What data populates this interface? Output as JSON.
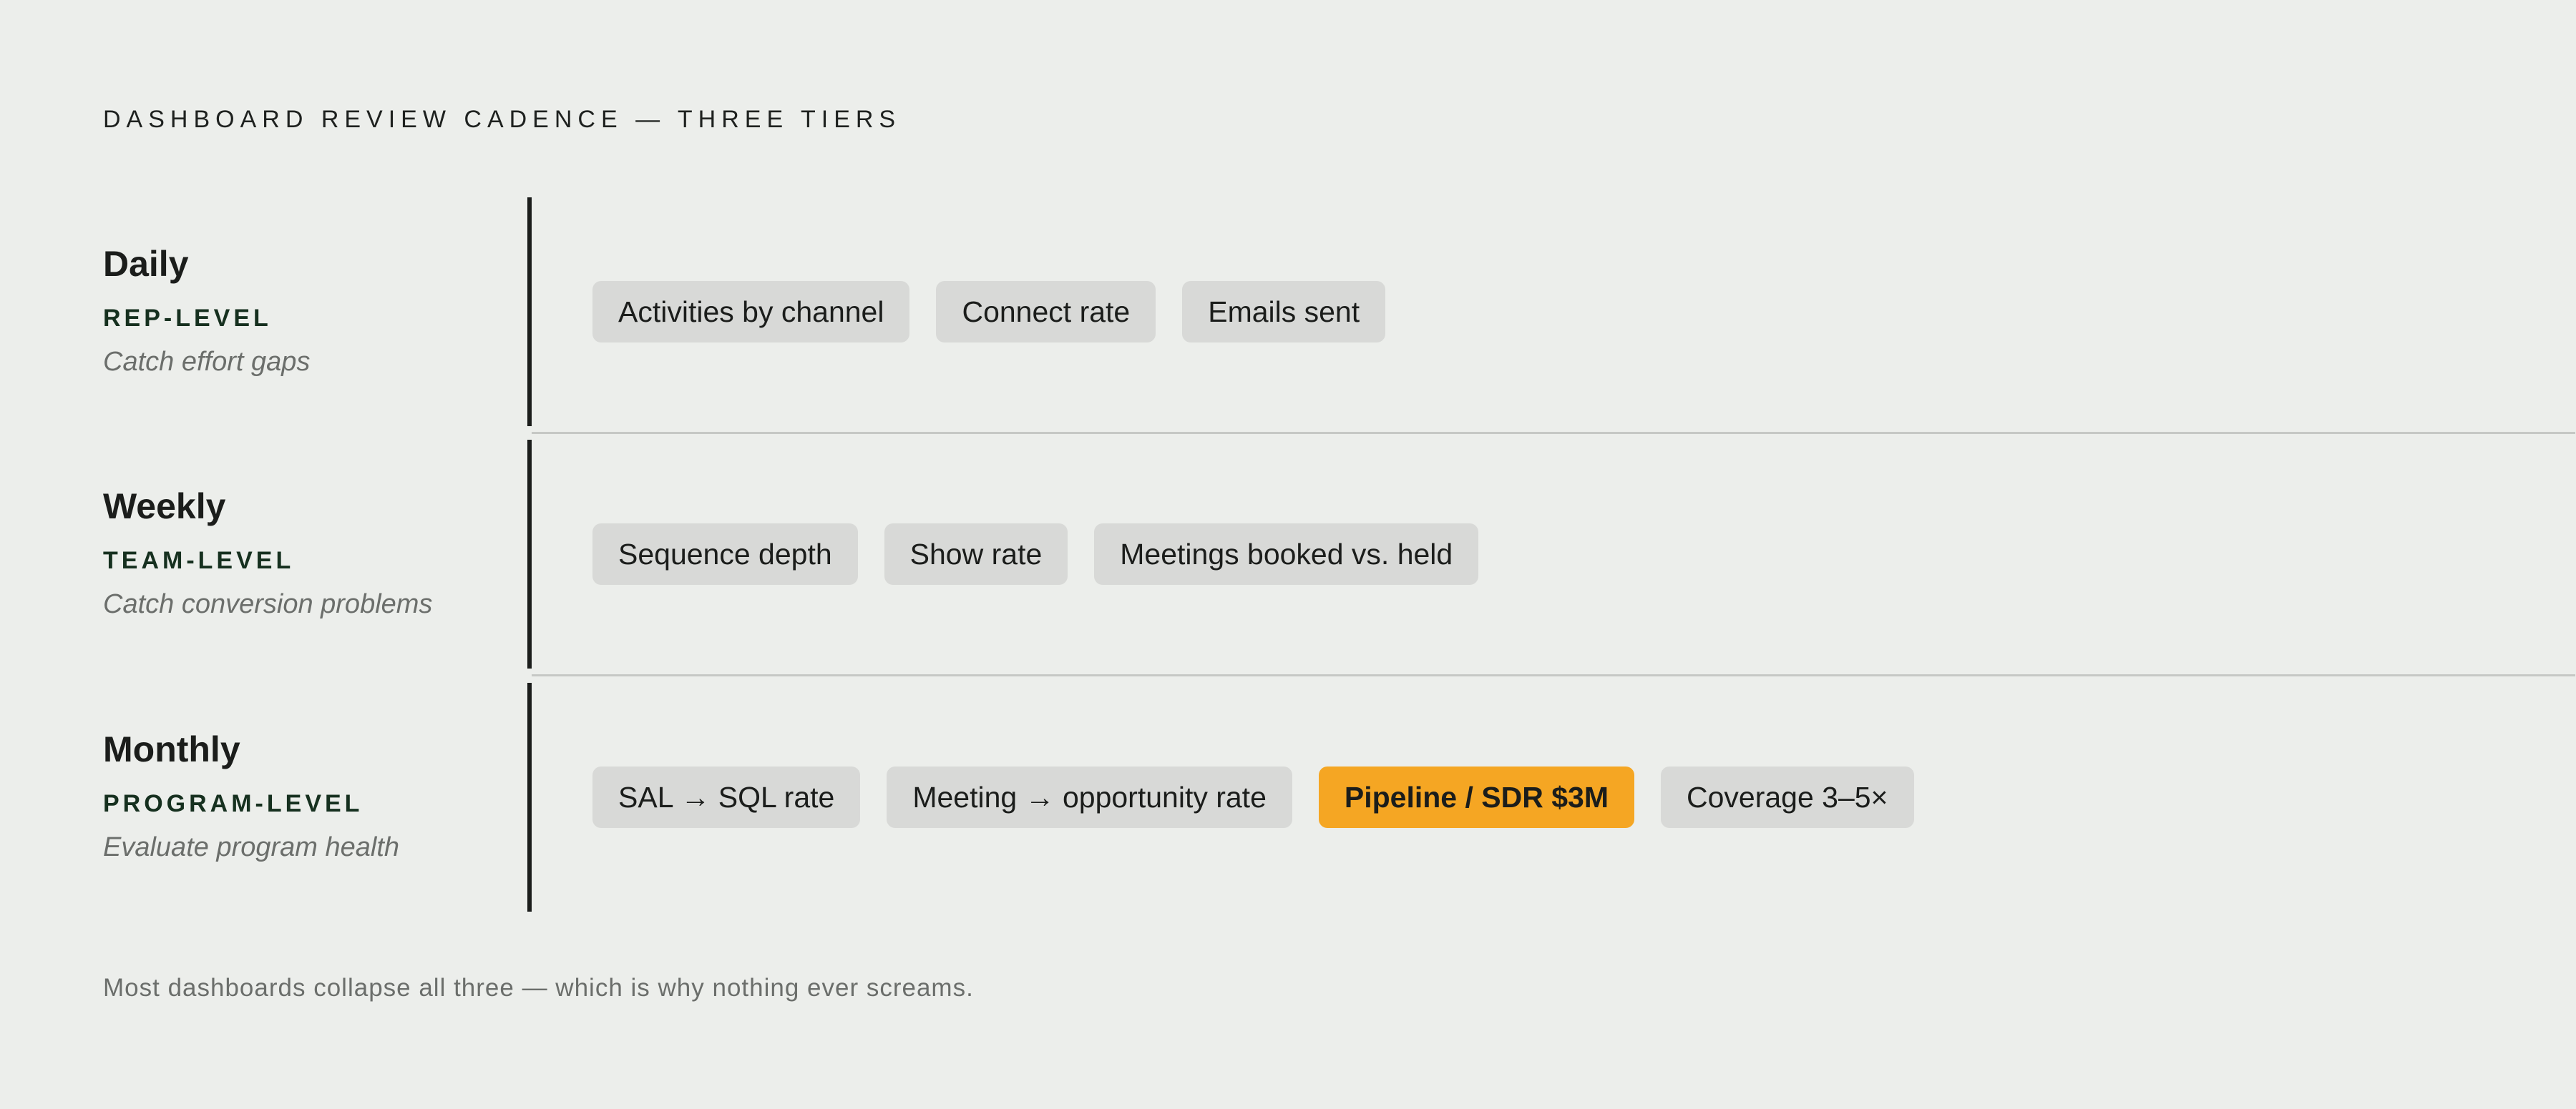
{
  "header": {
    "title": "DASHBOARD REVIEW CADENCE — THREE TIERS"
  },
  "tiers": [
    {
      "name": "Daily",
      "level": "REP-LEVEL",
      "description": "Catch effort gaps",
      "metrics": [
        {
          "label": "Activities by channel",
          "highlighted": false
        },
        {
          "label": "Connect rate",
          "highlighted": false
        },
        {
          "label": "Emails sent",
          "highlighted": false
        }
      ]
    },
    {
      "name": "Weekly",
      "level": "TEAM-LEVEL",
      "description": "Catch conversion problems",
      "metrics": [
        {
          "label": "Sequence depth",
          "highlighted": false
        },
        {
          "label": "Show rate",
          "highlighted": false
        },
        {
          "label": "Meetings booked vs. held",
          "highlighted": false
        }
      ]
    },
    {
      "name": "Monthly",
      "level": "PROGRAM-LEVEL",
      "description": "Evaluate program health",
      "metrics": [
        {
          "label": "SAL → SQL rate",
          "highlighted": false
        },
        {
          "label": "Meeting → opportunity rate",
          "highlighted": false
        },
        {
          "label": "Pipeline / SDR $3M",
          "highlighted": true
        },
        {
          "label": "Coverage 3–5×",
          "highlighted": false
        }
      ]
    }
  ],
  "footnote": "Most dashboards collapse all three — which is why nothing ever screams.",
  "colors": {
    "background": "#eceeeb",
    "chip": "#d8d9d7",
    "highlight": "#f5a623",
    "level_text": "#16301f",
    "muted_text": "#6b6e6b",
    "divider": "#1b1d1b"
  }
}
